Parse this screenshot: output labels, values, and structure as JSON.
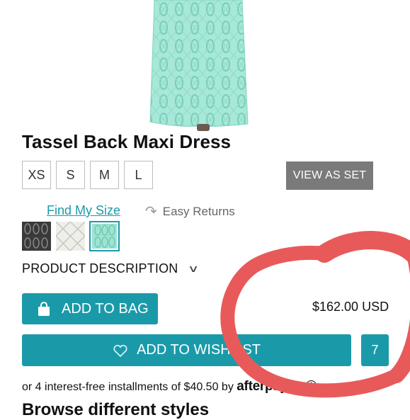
{
  "product": {
    "title": "Tassel Back Maxi Dress",
    "price": "$162.00 USD"
  },
  "sizes": [
    "XS",
    "S",
    "M",
    "L"
  ],
  "buttons": {
    "view_as_set": "VIEW AS SET",
    "add_to_bag": "ADD TO BAG",
    "add_to_wishlist": "ADD TO WISHLIST",
    "wishlist_count": "7"
  },
  "links": {
    "find_my_size": "Find My Size",
    "easy_returns": "Easy Returns"
  },
  "swatches": [
    {
      "name": "charcoal",
      "color": "#3a3a3a"
    },
    {
      "name": "white",
      "color": "#eeeeea"
    },
    {
      "name": "mint",
      "color": "#9fe3d3",
      "selected": true
    }
  ],
  "description": {
    "label": "PRODUCT DESCRIPTION"
  },
  "installments": {
    "text": "or 4 interest-free installments of $40.50 by",
    "brand": "afterpay"
  },
  "browse": {
    "heading": "Browse different styles"
  },
  "colors": {
    "accent": "#1a9aa9",
    "annotation": "#e85a5a",
    "view_as_set_bg": "#7a7a7a"
  }
}
